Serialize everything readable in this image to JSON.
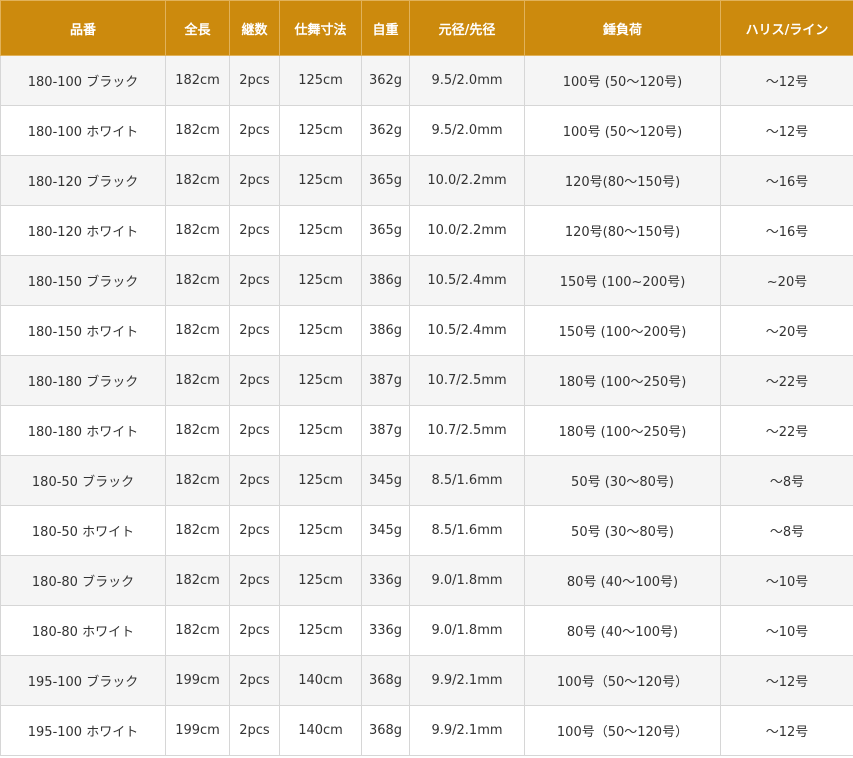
{
  "table": {
    "headers": [
      "品番",
      "全長",
      "継数",
      "仕舞寸法",
      "自重",
      "元径/先径",
      "錘負荷",
      "ハリス/ライン"
    ],
    "rows": [
      [
        "180-100 ブラック",
        "182cm",
        "2pcs",
        "125cm",
        "362g",
        "9.5/2.0mm",
        "100号 (50～120号)",
        "～12号"
      ],
      [
        "180-100 ホワイト",
        "182cm",
        "2pcs",
        "125cm",
        "362g",
        "9.5/2.0mm",
        "100号 (50～120号)",
        "～12号"
      ],
      [
        "180-120 ブラック",
        "182cm",
        "2pcs",
        "125cm",
        "365g",
        "10.0/2.2mm",
        "120号(80～150号)",
        "～16号"
      ],
      [
        "180-120 ホワイト",
        "182cm",
        "2pcs",
        "125cm",
        "365g",
        "10.0/2.2mm",
        "120号(80～150号)",
        "～16号"
      ],
      [
        "180-150 ブラック",
        "182cm",
        "2pcs",
        "125cm",
        "386g",
        "10.5/2.4mm",
        "150号 (100~200号)",
        "~20号"
      ],
      [
        "180-150 ホワイト",
        "182cm",
        "2pcs",
        "125cm",
        "386g",
        "10.5/2.4mm",
        "150号 (100～200号)",
        "～20号"
      ],
      [
        "180-180 ブラック",
        "182cm",
        "2pcs",
        "125cm",
        "387g",
        "10.7/2.5mm",
        "180号 (100～250号)",
        "～22号"
      ],
      [
        "180-180 ホワイト",
        "182cm",
        "2pcs",
        "125cm",
        "387g",
        "10.7/2.5mm",
        "180号 (100～250号)",
        "～22号"
      ],
      [
        "180-50 ブラック",
        "182cm",
        "2pcs",
        "125cm",
        "345g",
        "8.5/1.6mm",
        "50号 (30～80号)",
        "～8号"
      ],
      [
        "180-50 ホワイト",
        "182cm",
        "2pcs",
        "125cm",
        "345g",
        "8.5/1.6mm",
        "50号 (30～80号)",
        "～8号"
      ],
      [
        "180-80 ブラック",
        "182cm",
        "2pcs",
        "125cm",
        "336g",
        "9.0/1.8mm",
        "80号 (40～100号)",
        "～10号"
      ],
      [
        "180-80 ホワイト",
        "182cm",
        "2pcs",
        "125cm",
        "336g",
        "9.0/1.8mm",
        "80号 (40～100号)",
        "～10号"
      ],
      [
        "195-100 ブラック",
        "199cm",
        "2pcs",
        "140cm",
        "368g",
        "9.9/2.1mm",
        "100号（50～120号）",
        "～12号"
      ],
      [
        "195-100 ホワイト",
        "199cm",
        "2pcs",
        "140cm",
        "368g",
        "9.9/2.1mm",
        "100号（50～120号）",
        "～12号"
      ]
    ]
  },
  "colors": {
    "header_background": "#cc8a0d",
    "header_text": "#ffffff",
    "row_stripe": "#f5f5f5",
    "row_plain": "#ffffff",
    "border": "#d6d6d6"
  }
}
